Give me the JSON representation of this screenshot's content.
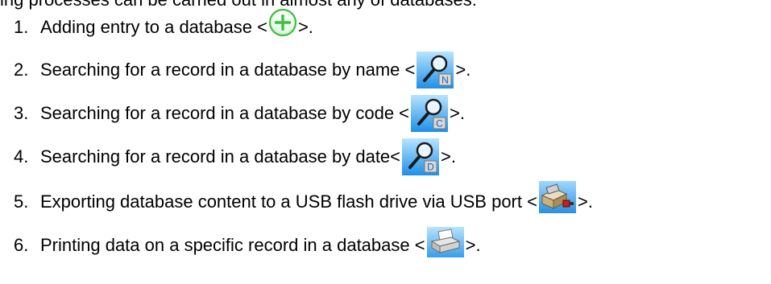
{
  "intro_text": "ing processes can be carried out in almost any of databases:",
  "items": [
    {
      "number": "1.",
      "text": "Adding entry to a database",
      "suffix": ">.",
      "icon": "add-circle-icon"
    },
    {
      "number": "2.",
      "text": "Searching for a record in a database by name",
      "suffix": ">.",
      "icon": "search-by-name-icon",
      "icon_letter": "N"
    },
    {
      "number": "3.",
      "text": "Searching for a record in a database by code",
      "suffix": ">.",
      "icon": "search-by-code-icon",
      "icon_letter": "C"
    },
    {
      "number": "4.",
      "text": "Searching for a record in a database by date",
      "suffix": ">.",
      "icon": "search-by-date-icon",
      "icon_letter": "D"
    },
    {
      "number": "5.",
      "text": "Exporting database content to a USB flash drive via USB port",
      "suffix": ">.",
      "icon": "usb-export-icon"
    },
    {
      "number": "6.",
      "text": "Printing data on a specific record in a database",
      "suffix": ">.",
      "icon": "printer-icon"
    }
  ],
  "colors": {
    "text": "#000000",
    "plus_green": "#3fbf3f",
    "icon_blue_light": "#9fd8ff",
    "icon_blue_dark": "#1e90e6"
  }
}
